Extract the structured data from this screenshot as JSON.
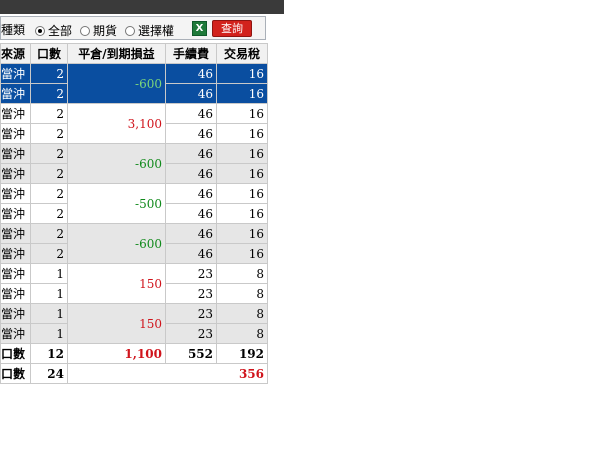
{
  "filter": {
    "label": "種類",
    "options": [
      {
        "label": "全部",
        "selected": true
      },
      {
        "label": "期貨",
        "selected": false
      },
      {
        "label": "選擇權",
        "selected": false
      }
    ],
    "export_icon": "excel-icon",
    "query_label": "查詢"
  },
  "table": {
    "headers": [
      "來源",
      "口數",
      "平倉/到期損益",
      "手續費",
      "交易稅"
    ],
    "rows": [
      {
        "source": "當沖",
        "qty": "2",
        "fee": "46",
        "tax": "16"
      },
      {
        "source": "當沖",
        "qty": "2",
        "fee": "46",
        "tax": "16"
      },
      {
        "source": "當沖",
        "qty": "2",
        "fee": "46",
        "tax": "16"
      },
      {
        "source": "當沖",
        "qty": "2",
        "fee": "46",
        "tax": "16"
      },
      {
        "source": "當沖",
        "qty": "2",
        "fee": "46",
        "tax": "16"
      },
      {
        "source": "當沖",
        "qty": "2",
        "fee": "46",
        "tax": "16"
      },
      {
        "source": "當沖",
        "qty": "2",
        "fee": "46",
        "tax": "16"
      },
      {
        "source": "當沖",
        "qty": "2",
        "fee": "46",
        "tax": "16"
      },
      {
        "source": "當沖",
        "qty": "2",
        "fee": "46",
        "tax": "16"
      },
      {
        "source": "當沖",
        "qty": "2",
        "fee": "46",
        "tax": "16"
      },
      {
        "source": "當沖",
        "qty": "1",
        "fee": "23",
        "tax": "8"
      },
      {
        "source": "當沖",
        "qty": "1",
        "fee": "23",
        "tax": "8"
      },
      {
        "source": "當沖",
        "qty": "1",
        "fee": "23",
        "tax": "8"
      },
      {
        "source": "當沖",
        "qty": "1",
        "fee": "23",
        "tax": "8"
      }
    ],
    "pnl_groups": [
      "-600",
      "3,100",
      "-600",
      "-500",
      "-600",
      "150",
      "150"
    ],
    "total": {
      "label": "口數",
      "qty": "12",
      "pnl": "1,100",
      "fee": "552",
      "tax": "192"
    },
    "grand": {
      "label": "口數",
      "qty": "24",
      "net": "356"
    }
  },
  "colors": {
    "selected_row": "#0a4ea0",
    "profit": "#d0141c",
    "loss": "#118a1c",
    "alt_row": "#e6e6e6"
  }
}
